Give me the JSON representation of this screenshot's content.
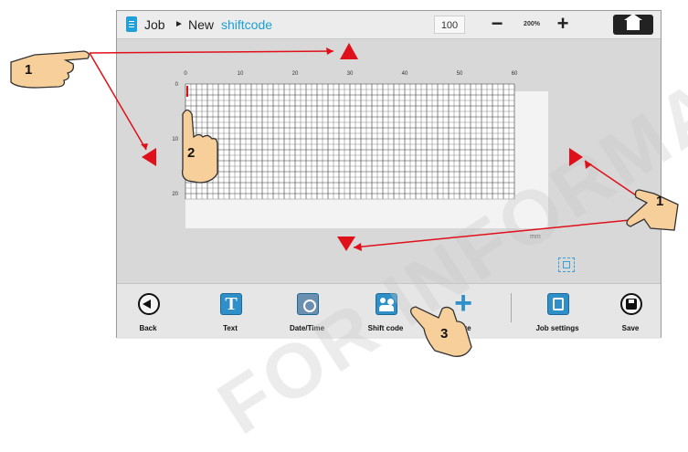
{
  "header": {
    "crumb_root": "Job",
    "crumb_sep": "►",
    "crumb_mid": "New",
    "crumb_current": "shiftcode",
    "zoom_value": "100",
    "zoom_minus": "−",
    "zoom_preset": "200%",
    "zoom_plus": "+"
  },
  "editor": {
    "x_ticks": [
      "0",
      "10",
      "20",
      "30",
      "40",
      "50",
      "60"
    ],
    "y_ticks": [
      "0",
      "10",
      "20"
    ],
    "unit": "mm"
  },
  "toolbar": {
    "items": [
      {
        "label": "Back",
        "icon": "back-arrow-icon"
      },
      {
        "label": "Text",
        "icon": "text-icon"
      },
      {
        "label": "Date/Time",
        "icon": "date-time-icon"
      },
      {
        "label": "Shift code",
        "icon": "shift-code-icon"
      },
      {
        "label": "More",
        "icon": "plus-icon"
      },
      {
        "label": "Job settings",
        "icon": "job-settings-icon"
      },
      {
        "label": "Save",
        "icon": "save-icon"
      }
    ]
  },
  "callouts": {
    "one": "1",
    "two": "2",
    "three": "3"
  },
  "watermark": "FOR INFORMATION",
  "colors": {
    "accent": "#1a9fd8",
    "arrow": "#e0101a",
    "hand": "#f7cf9a"
  }
}
